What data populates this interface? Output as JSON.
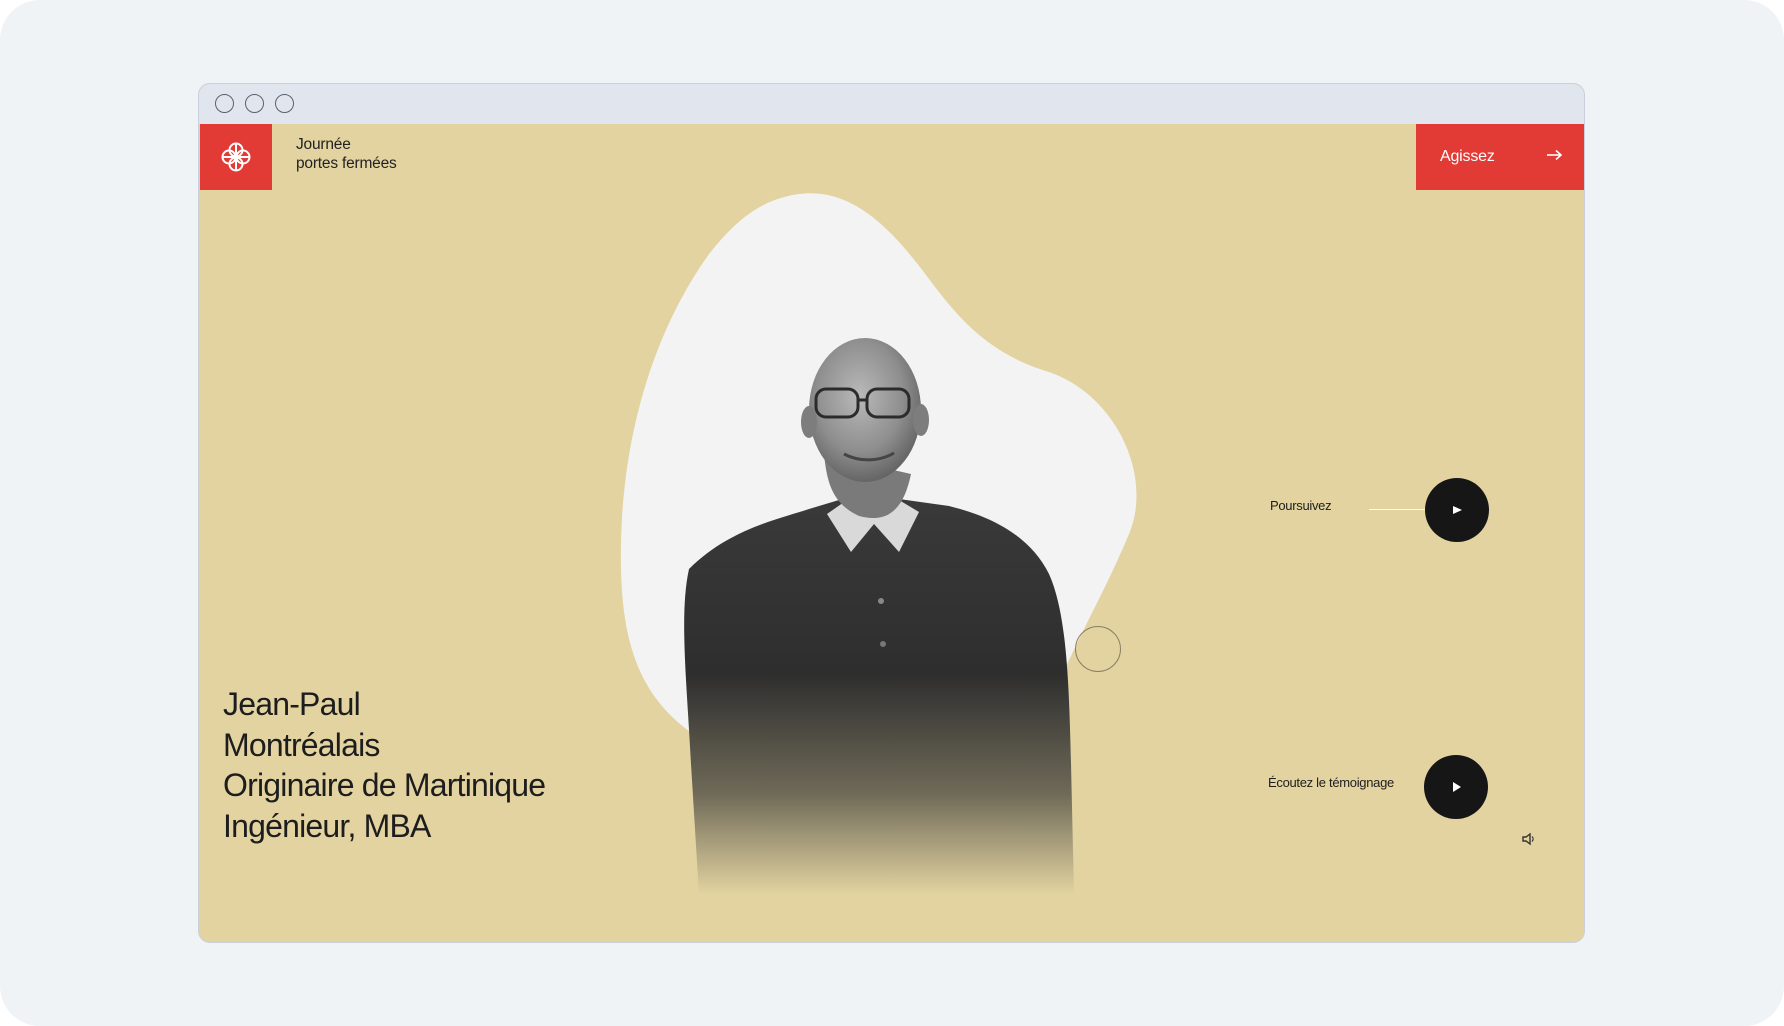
{
  "header": {
    "brand_line1": "Journée",
    "brand_line2": "portes fermées",
    "cta_label": "Agissez",
    "cta_icon": "arrow-right-icon"
  },
  "profile": {
    "lines": [
      "Jean-Paul",
      "Montréalais",
      "Originaire de Martinique",
      "Ingénieur, MBA"
    ]
  },
  "actions": {
    "next_label": "Poursuivez",
    "listen_label": "Écoutez le témoignage"
  },
  "icons": {
    "logo": "montreal-flower-logo-icon",
    "next": "arrow-right-icon",
    "play": "play-icon",
    "sound": "speaker-icon"
  },
  "colors": {
    "page_background": "#e2d3a0",
    "accent_red": "#e23a35",
    "button_dark": "#161616",
    "blob": "#f3f3f3"
  }
}
